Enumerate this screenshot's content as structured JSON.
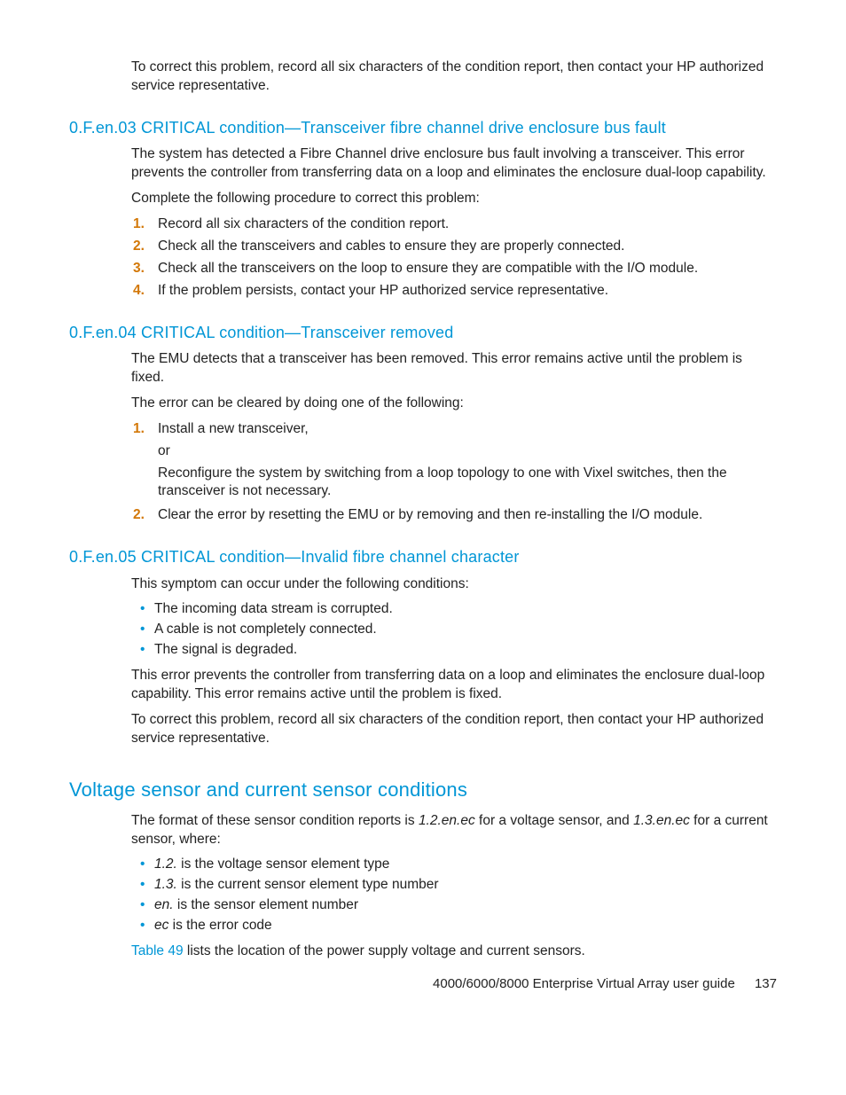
{
  "intro_para": "To correct this problem, record all six characters of the condition report, then contact your HP authorized service representative.",
  "s1": {
    "heading": "0.F.en.03 CRITICAL condition—Transceiver fibre channel drive enclosure bus fault",
    "p1": "The system has detected a Fibre Channel drive enclosure bus fault involving a transceiver. This error prevents the controller from transferring data on a loop and eliminates the enclosure dual-loop capability.",
    "p2": "Complete the following procedure to correct this problem:",
    "items": [
      "Record all six characters of the condition report.",
      "Check all the transceivers and cables to ensure they are properly connected.",
      "Check all the transceivers on the loop to ensure they are compatible with the I/O module.",
      "If the problem persists, contact your HP authorized service representative."
    ]
  },
  "s2": {
    "heading": "0.F.en.04 CRITICAL condition—Transceiver removed",
    "p1": "The EMU detects that a transceiver has been removed. This error remains active until the problem is fixed.",
    "p2": "The error can be cleared by doing one of the following:",
    "li1": "Install a new transceiver,",
    "or": "or",
    "li1b": "Reconfigure the system by switching from a loop topology to one with Vixel switches, then the transceiver is not necessary.",
    "li2": "Clear the error by resetting the EMU or by removing and then re-installing the I/O module."
  },
  "s3": {
    "heading": "0.F.en.05 CRITICAL condition—Invalid fibre channel character",
    "p1": "This symptom can occur under the following conditions:",
    "bullets": [
      "The incoming data stream is corrupted.",
      "A cable is not completely connected.",
      "The signal is degraded."
    ],
    "p2": "This error prevents the controller from transferring data on a loop and eliminates the enclosure dual-loop capability. This error remains active until the problem is fixed.",
    "p3": "To correct this problem, record all six characters of the condition report, then contact your HP authorized service representative."
  },
  "s4": {
    "heading": "Voltage sensor and current sensor conditions",
    "p1_a": "The format of these sensor condition reports is ",
    "p1_i1": "1.2.en.ec",
    "p1_b": " for a voltage sensor, and ",
    "p1_i2": "1.3.en.ec",
    "p1_c": " for a current sensor, where:",
    "b1_i": "1.2.",
    "b1_t": " is the voltage sensor element type",
    "b2_i": "1.3.",
    "b2_t": " is the current sensor element type number",
    "b3_i": "en.",
    "b3_t": " is the sensor element number",
    "b4_i": "ec",
    "b4_t": " is the error code",
    "p2_link": "Table 49",
    "p2_rest": " lists the location of the power supply voltage and current sensors."
  },
  "footer": {
    "title": "4000/6000/8000 Enterprise Virtual Array user guide",
    "page": "137"
  },
  "nums": {
    "n1": "1.",
    "n2": "2.",
    "n3": "3.",
    "n4": "4."
  }
}
